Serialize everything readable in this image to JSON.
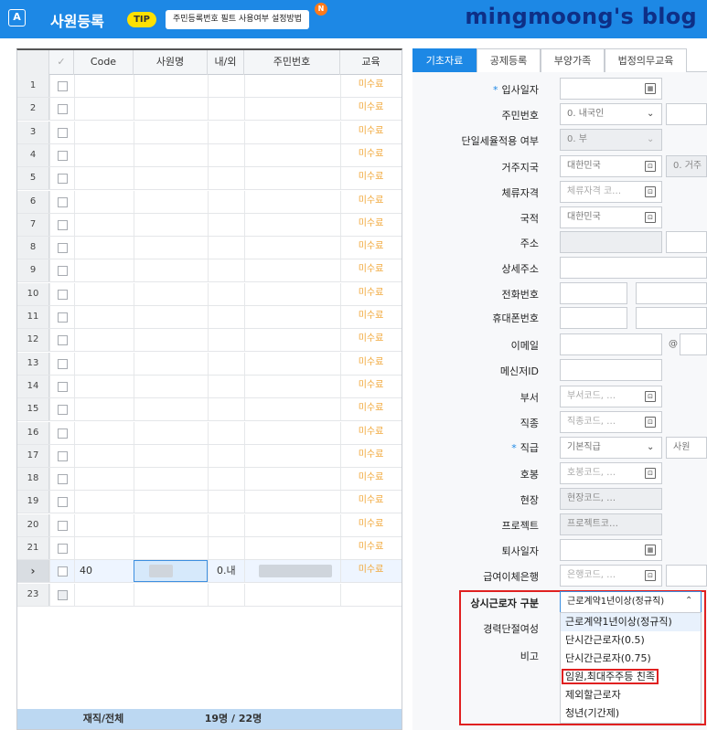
{
  "header": {
    "app_icon": "A",
    "title": "사원등록",
    "tip_badge": "TIP",
    "tip_text": "주민등록번호 필트 사용여부 설정방법",
    "new_badge": "N",
    "watermark": "mingmoong's blog"
  },
  "grid": {
    "columns": [
      "",
      "✓",
      "Code",
      "사원명",
      "내/외",
      "주민번호",
      "교육"
    ],
    "rows": [
      {
        "num": "1",
        "status": "미수료"
      },
      {
        "num": "2",
        "status": "미수료"
      },
      {
        "num": "3",
        "status": "미수료"
      },
      {
        "num": "4",
        "status": "미수료"
      },
      {
        "num": "5",
        "status": "미수료"
      },
      {
        "num": "6",
        "status": "미수료"
      },
      {
        "num": "7",
        "status": "미수료"
      },
      {
        "num": "8",
        "status": "미수료"
      },
      {
        "num": "9",
        "status": "미수료"
      },
      {
        "num": "10",
        "status": "미수료"
      },
      {
        "num": "11",
        "status": "미수료"
      },
      {
        "num": "12",
        "status": "미수료"
      },
      {
        "num": "13",
        "status": "미수료"
      },
      {
        "num": "14",
        "status": "미수료"
      },
      {
        "num": "15",
        "status": "미수료"
      },
      {
        "num": "16",
        "status": "미수료"
      },
      {
        "num": "17",
        "status": "미수료"
      },
      {
        "num": "18",
        "status": "미수료"
      },
      {
        "num": "19",
        "status": "미수료"
      },
      {
        "num": "20",
        "status": "미수료"
      },
      {
        "num": "21",
        "status": "미수료"
      }
    ],
    "selected_row": {
      "marker": "›",
      "code": "40",
      "inout": "0.내",
      "status": "미수료"
    },
    "new_row": {
      "num": "23"
    },
    "footer_label": "재직/전체",
    "footer_count": "19명 / 22명"
  },
  "tabs": [
    "기초자료",
    "공제등록",
    "부양가족",
    "법정의무교육"
  ],
  "form": {
    "hire_date_label": "입사일자",
    "resident_type_label": "주민번호",
    "resident_type_value": "0. 내국인",
    "single_tax_label": "단일세율적용 여부",
    "single_tax_value": "0. 부",
    "residence_label": "거주지국",
    "residence_value": "대한민국",
    "residence_extra": "0. 거주",
    "stay_label": "체류자격",
    "stay_placeholder": "체류자격 코…",
    "nationality_label": "국적",
    "nationality_value": "대한민국",
    "address_label": "주소",
    "address_detail_label": "상세주소",
    "phone_label": "전화번호",
    "mobile_label": "휴대폰번호",
    "email_label": "이메일",
    "email_at": "@",
    "messenger_label": "메신저ID",
    "dept_label": "부서",
    "dept_placeholder": "부서코드, …",
    "job_label": "직종",
    "job_placeholder": "직종코드, …",
    "rank_label": "직급",
    "rank_value": "기본직급",
    "rank_extra": "사원",
    "grade_label": "호봉",
    "grade_placeholder": "호봉코드, …",
    "site_label": "현장",
    "site_placeholder": "현장코드, …",
    "project_label": "프로젝트",
    "project_placeholder": "프로젝트코…",
    "leave_date_label": "퇴사일자",
    "bank_label": "급여이체은행",
    "bank_placeholder": "은행코드, …",
    "regular_worker_label": "상시근로자 구분",
    "regular_worker_value": "근로계약1년이상(정규직)",
    "career_break_label": "경력단절여성",
    "note_label": "비고"
  },
  "dropdown_options": [
    "근로계약1년이상(정규직)",
    "단시간근로자(0.5)",
    "단시간근로자(0.75)",
    "임원,최대주주등 친족",
    "제외할근로자",
    "청년(기간제)"
  ],
  "icons": {
    "calendar": "calendar-icon",
    "code_help": "code-help-icon",
    "chevron": "chevron-down-icon"
  },
  "colors": {
    "header_blue": "#1d88e5",
    "tip_yellow": "#ffe000",
    "status_orange": "#f1a83b",
    "highlight_red": "#e02020",
    "watermark_navy": "#0e2f86"
  }
}
